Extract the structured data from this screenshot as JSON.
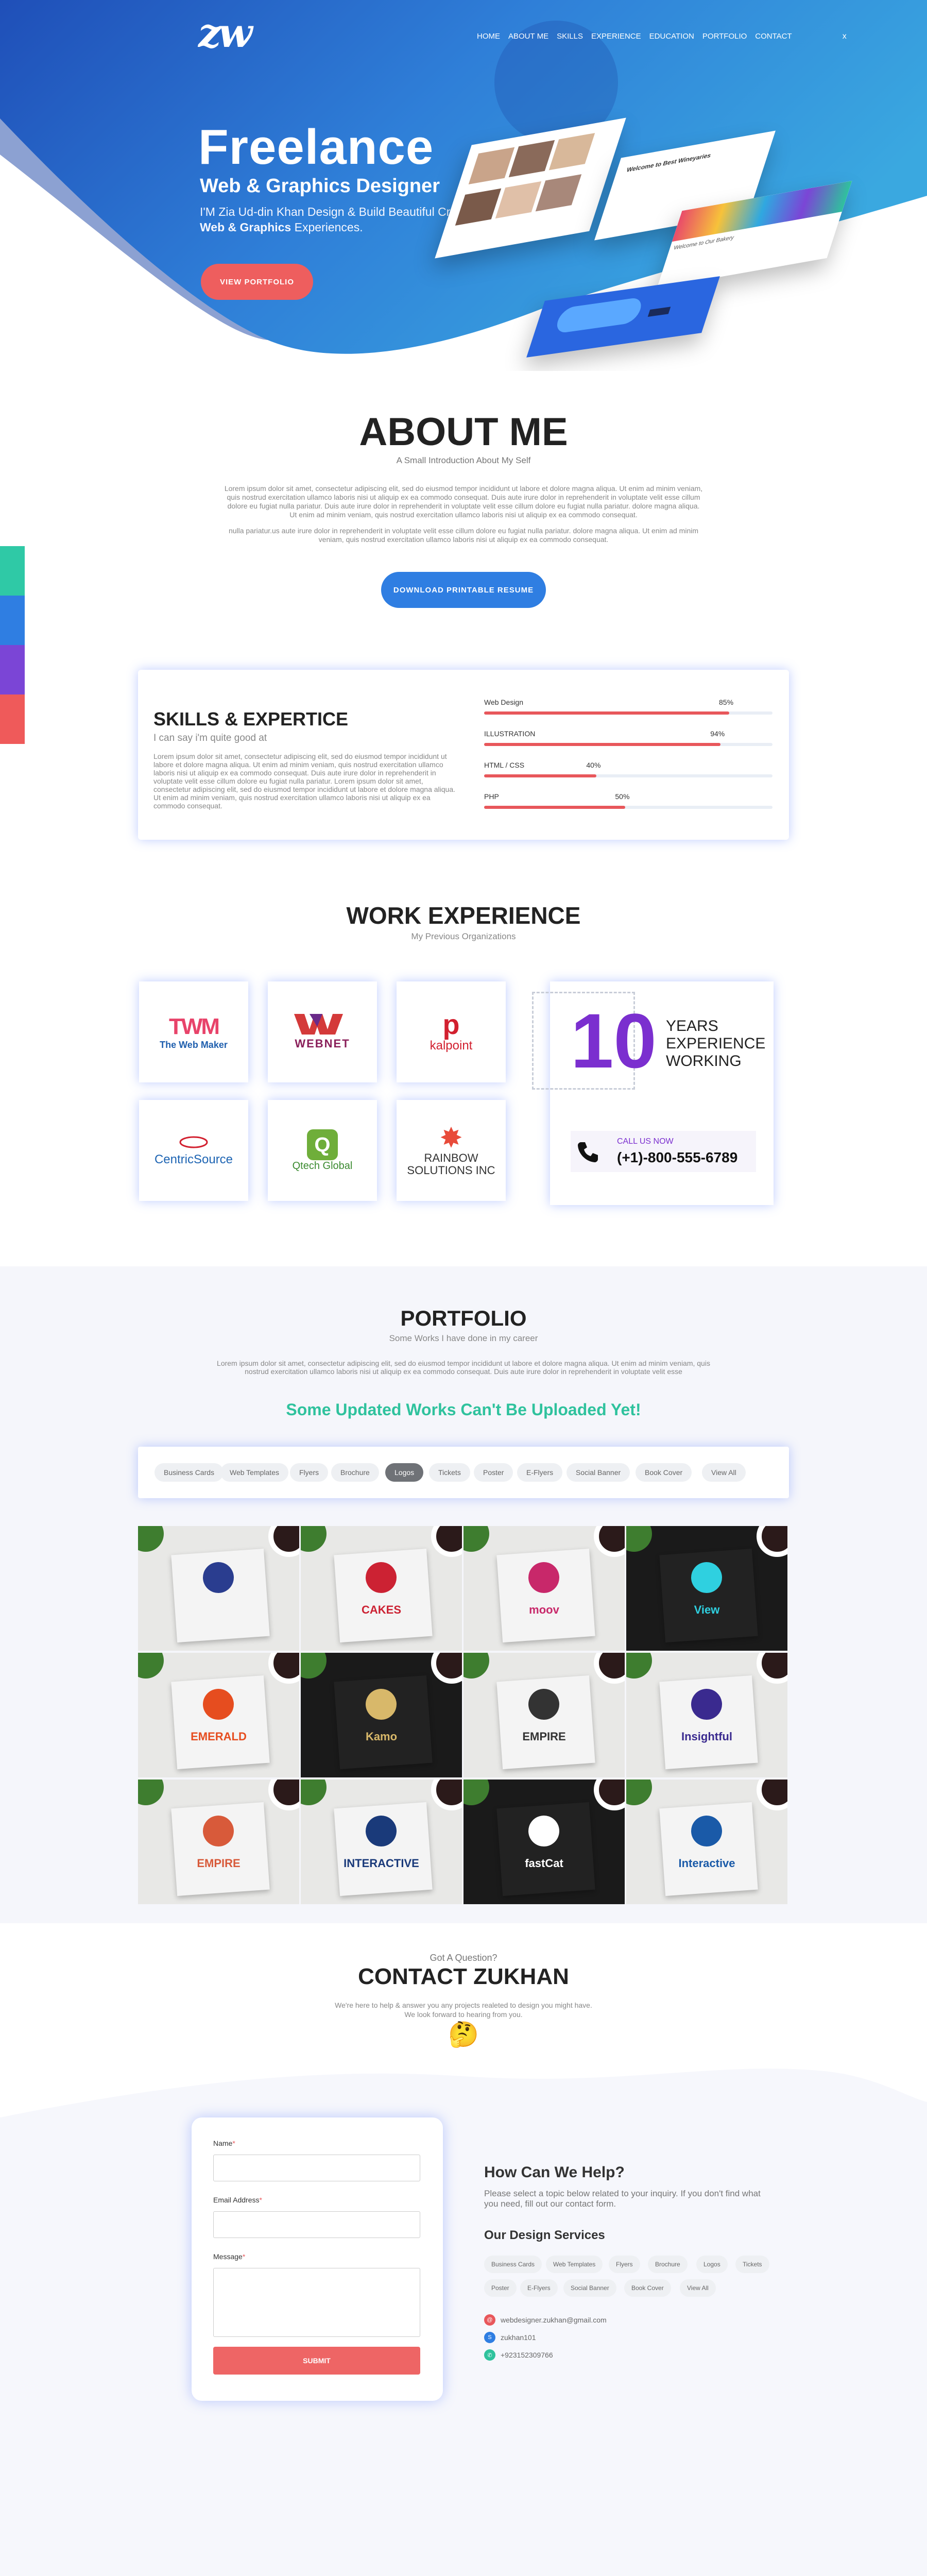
{
  "header": {
    "logo": "zw",
    "nav": [
      "HOME",
      "ABOUT ME",
      "SKILLS",
      "EXPERIENCE",
      "EDUCATION",
      "PORTFOLIO",
      "CONTACT"
    ],
    "close_glyph": "x"
  },
  "hero": {
    "title": "Freelance",
    "subtitle": "Web & Graphics Designer",
    "tagline_1": "I'M Zia Ud-din Khan Design & Build Beautiful Crafted",
    "tagline_2_bold": "Web & Graphics",
    "tagline_2_rest": " Experiences.",
    "cta": "VIEW PORTFOLIO",
    "mockup_1_text": "Welcome to Best Wineyaries",
    "mockup_2_text": "Welcome to Our Bakery"
  },
  "about": {
    "title": "ABOUT ME",
    "subtitle": "A Small Introduction About My Self",
    "paragraph_1": "Lorem ipsum dolor sit amet, consectetur adipiscing elit, sed do eiusmod tempor incididunt ut labore et dolore magna aliqua. Ut enim ad minim veniam, quis nostrud exercitation ullamco laboris nisi ut aliquip ex ea commodo consequat. Duis aute irure dolor in reprehenderit in voluptate velit esse cillum dolore eu fugiat nulla pariatur. Duis aute irure dolor in reprehenderit in voluptate velit esse cillum dolore eu fugiat nulla pariatur. dolore magna aliqua. Ut enim ad minim veniam, quis nostrud exercitation ullamco laboris nisi ut aliquip ex ea commodo consequat.",
    "paragraph_2": "nulla pariatur.us aute irure dolor in reprehenderit in voluptate velit esse cillum dolore eu fugiat nulla pariatur. dolore magna aliqua. Ut enim ad minim veniam, quis nostrud exercitation ullamco laboris nisi ut aliquip ex ea commodo consequat.",
    "cta": "DOWNLOAD PRINTABLE RESUME"
  },
  "side_colors": [
    "#2fc9a6",
    "#2f7ee2",
    "#7b45d6",
    "#ef5a5a"
  ],
  "skills": {
    "title": "SKILLS & EXPERTICE",
    "subtitle": "I can say i'm quite good at",
    "text": "Lorem ipsum dolor sit amet, consectetur adipiscing elit, sed do eiusmod tempor incididunt ut labore et dolore magna aliqua. Ut enim ad minim veniam, quis nostrud exercitation ullamco laboris nisi ut aliquip ex ea commodo consequat. Duis aute irure dolor in reprehenderit in voluptate velit esse cillum dolore eu fugiat nulla pariatur. Lorem ipsum dolor sit amet, consectetur adipiscing elit, sed do eiusmod tempor incididunt ut labore et dolore magna aliqua. Ut enim ad minim veniam, quis nostrud exercitation ullamco laboris nisi ut aliquip ex ea commodo consequat.",
    "items": [
      {
        "name": "Web Design",
        "percent_label": "85%",
        "value": 0.85
      },
      {
        "name": "ILLUSTRATION",
        "percent_label": "94%",
        "value": 0.82
      },
      {
        "name": "HTML / CSS",
        "percent_label": "40%",
        "value": 0.39
      },
      {
        "name": "PHP",
        "percent_label": "50%",
        "value": 0.49
      }
    ],
    "accent": "#e8575b"
  },
  "experience": {
    "title": "WORK EXPERIENCE",
    "subtitle": "My Previous Organizations",
    "companies": [
      {
        "name": "The Web Maker",
        "mark": "TWM",
        "color": "#1f5fae",
        "accent": "#e8436a"
      },
      {
        "name": "WEBNET",
        "mark": "WEBNET",
        "color": "#8a1f5a",
        "accent": "#d43a3a"
      },
      {
        "name": "kalpoint",
        "mark": "p",
        "color": "#d2202f",
        "accent": "#333"
      },
      {
        "name": "CentricSource",
        "mark": "CentricSource",
        "color": "#1d64b3",
        "accent": "#d2202f"
      },
      {
        "name": "Qtech Global",
        "mark": "Q",
        "color": "#6fae3a",
        "accent": "#3a8a2f"
      },
      {
        "name": "RAINBOW SOLUTIONS INC",
        "mark": "✸",
        "color": "#333",
        "accent": "#e84b3a"
      }
    ],
    "years_number": "10",
    "years_line_1": "YEARS",
    "years_line_2": "EXPERIENCE",
    "years_line_3": "WORKING",
    "call_label": "CALL US NOW",
    "phone": "(+1)-800-555-6789"
  },
  "portfolio": {
    "title": "PORTFOLIO",
    "subtitle": "Some Works I have done in my career",
    "text": "Lorem ipsum dolor sit amet, consectetur adipiscing elit, sed do eiusmod tempor incididunt ut labore et dolore magna aliqua. Ut enim ad minim veniam, quis nostrud exercitation ullamco laboris nisi ut aliquip ex ea commodo consequat. Duis aute irure dolor in reprehenderit in voluptate velit esse",
    "notice": "Some Updated Works Can't Be Uploaded Yet!",
    "filters": [
      "Business Cards",
      "Web Templates",
      "Flyers",
      "Brochure",
      "Logos",
      "Tickets",
      "Poster",
      "E-Flyers",
      "Social Banner",
      "Book Cover",
      "View All"
    ],
    "active_filter": "Logos",
    "tiles": [
      {
        "name": "",
        "color": "#2a3d8f",
        "dark": false
      },
      {
        "name": "CAKES",
        "color": "#cc2233",
        "dark": false
      },
      {
        "name": "moov",
        "color": "#c8286a",
        "dark": false
      },
      {
        "name": "View",
        "color": "#2fd0e0",
        "dark": true
      },
      {
        "name": "EMERALD",
        "color": "#e64d1f",
        "dark": false
      },
      {
        "name": "Kamo",
        "color": "#d8b86a",
        "dark": true
      },
      {
        "name": "EMPIRE",
        "color": "#333333",
        "dark": false
      },
      {
        "name": "Insightful",
        "color": "#3a2a8f",
        "dark": false
      },
      {
        "name": "EMPIRE",
        "color": "#d85a3a",
        "dark": false
      },
      {
        "name": "INTERACTIVE",
        "color": "#1a3a7a",
        "dark": false
      },
      {
        "name": "fastCat",
        "color": "#ffffff",
        "dark": true
      },
      {
        "name": "Interactive",
        "color": "#1a5aa8",
        "dark": false
      }
    ]
  },
  "contact": {
    "pretitle": "Got A Question?",
    "title": "CONTACT ZUKHAN",
    "text_1": "We're here to help & answer you any projects realeted to design you might have.",
    "text_2": "We look forward to hearing from you.",
    "emoji": "🤔",
    "form": {
      "name_label": "Name",
      "email_label": "Email Address",
      "message_label": "Message",
      "required_mark": "*",
      "submit": "SUBMIT"
    },
    "help_title": "How Can We Help?",
    "help_text": "Please select a topic below related to your inquiry. If you don't find what you need, fill out our contact form.",
    "services_title": "Our Design Services",
    "services": [
      "Business Cards",
      "Web Templates",
      "Flyers",
      "Brochure",
      "Logos",
      "Tickets",
      "Poster",
      "E-Flyers",
      "Social Banner",
      "Book Cover",
      "View All"
    ],
    "email": "webdesigner.zukhan@gmail.com",
    "skype": "zukhan101",
    "whatsapp": "+923152309766"
  }
}
